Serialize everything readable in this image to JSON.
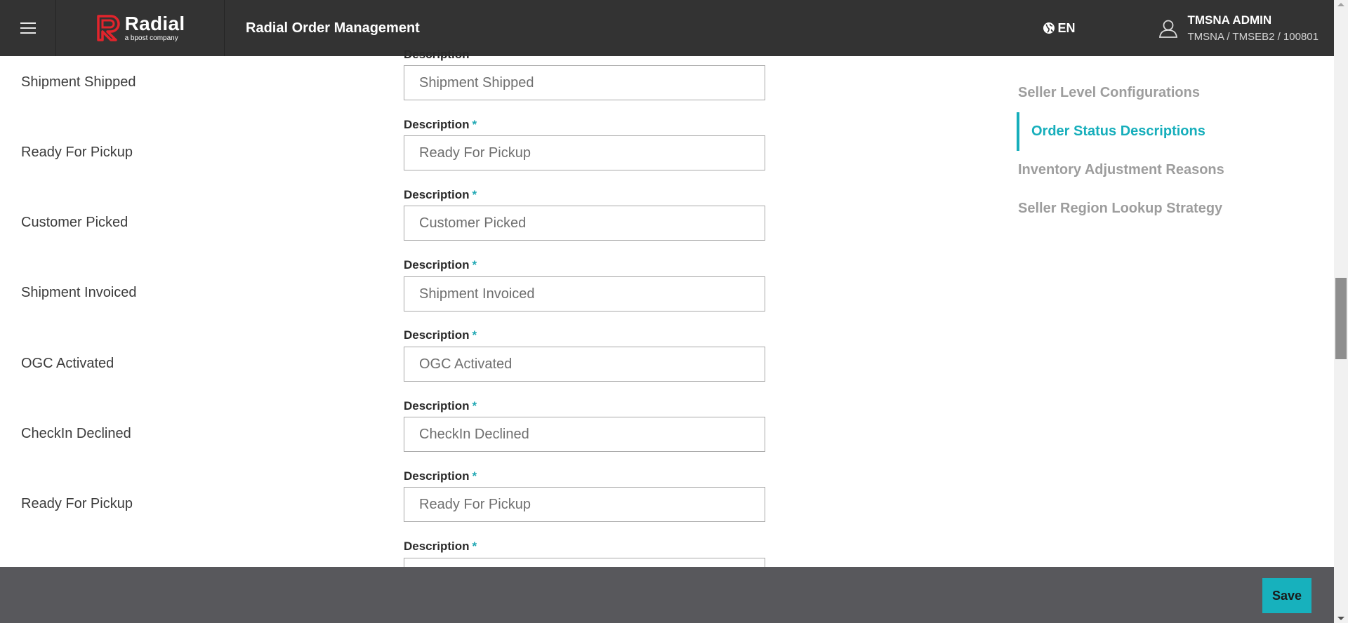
{
  "header": {
    "logo_name": "Radial",
    "logo_sub": "a bpost company",
    "title": "Radial Order Management",
    "language": "EN",
    "user_name": "TMSNA ADMIN",
    "user_path": "TMSNA / TMSEB2 / 100801"
  },
  "main": {
    "top_partial_label": "Description",
    "rows": [
      {
        "status": "Shipment Shipped",
        "description_label": "Description",
        "value": "Shipment Shipped"
      },
      {
        "status": "Ready For Pickup",
        "description_label": "Description",
        "value": "Ready For Pickup"
      },
      {
        "status": "Customer Picked",
        "description_label": "Description",
        "value": "Customer Picked"
      },
      {
        "status": "Shipment Invoiced",
        "description_label": "Description",
        "value": "Shipment Invoiced"
      },
      {
        "status": "OGC Activated",
        "description_label": "Description",
        "value": "OGC Activated"
      },
      {
        "status": "CheckIn Declined",
        "description_label": "Description",
        "value": "CheckIn Declined"
      },
      {
        "status": "Ready For Pickup",
        "description_label": "Description",
        "value": "Ready For Pickup"
      }
    ],
    "bottom_partial_label": "Description",
    "required_marker": "*"
  },
  "side_nav": {
    "items": [
      {
        "label": "Seller Level Configurations",
        "active": false
      },
      {
        "label": "Order Status Descriptions",
        "active": true
      },
      {
        "label": "Inventory Adjustment Reasons",
        "active": false
      },
      {
        "label": "Seller Region Lookup Strategy",
        "active": false
      }
    ]
  },
  "footer": {
    "save_label": "Save"
  },
  "colors": {
    "accent": "#16aebb",
    "header_bg": "#333333",
    "footer_bg": "#58585c",
    "logo_red": "#e2242c"
  }
}
